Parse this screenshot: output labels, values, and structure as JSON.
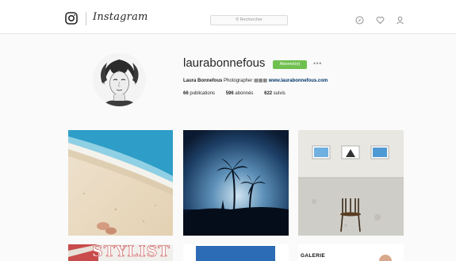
{
  "nav": {
    "wordmark": "Instagram",
    "search_placeholder": "Rechercher",
    "icons": [
      "instagram-camera-icon",
      "explore-compass-icon",
      "heart-icon",
      "profile-icon"
    ]
  },
  "profile": {
    "username": "laurabonnefous",
    "follow_label": "Abonné(e)",
    "more_label": "•••",
    "bio_name": "Laura Bonnefous",
    "bio_text": "Photographer",
    "bio_emoji": "▦▦▦",
    "bio_link": "www.laurabonnefous.com",
    "stats": [
      {
        "count": "66",
        "label": "publications"
      },
      {
        "count": "596",
        "label": "abonnés"
      },
      {
        "count": "622",
        "label": "suivis"
      }
    ]
  },
  "posts": {
    "row2_texts": [
      "STYLIST",
      "GALERIE"
    ]
  },
  "colors": {
    "follow_green": "#70c050",
    "link_blue": "#003569",
    "border": "#e6e6e6"
  }
}
